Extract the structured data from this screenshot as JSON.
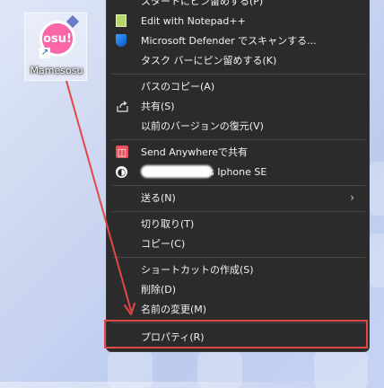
{
  "desktop_icon": {
    "label": "Mamesosu",
    "logo_text": "osu!"
  },
  "menu": {
    "items": [
      {
        "label": "スタートにピン留めする(P)",
        "icon": "none"
      },
      {
        "label": "Edit with Notepad++",
        "icon": "notepad-icon"
      },
      {
        "label": "Microsoft Defender でスキャンする...",
        "icon": "defender-shield-icon"
      },
      {
        "label": "タスク バーにピン留めする(K)",
        "icon": "none"
      },
      {
        "label": "パスのコピー(A)",
        "icon": "none"
      },
      {
        "label": "共有(S)",
        "icon": "share-icon"
      },
      {
        "label": "以前のバージョンの復元(V)",
        "icon": "none"
      },
      {
        "label": "Send Anywhereで共有",
        "icon": "send-anywhere-icon"
      },
      {
        "label": "s Iphone SE",
        "icon": "bluetooth-device-icon"
      },
      {
        "label": "送る(N)",
        "icon": "none"
      },
      {
        "label": "切り取り(T)",
        "icon": "none"
      },
      {
        "label": "コピー(C)",
        "icon": "none"
      },
      {
        "label": "ショートカットの作成(S)",
        "icon": "none"
      },
      {
        "label": "削除(D)",
        "icon": "none"
      },
      {
        "label": "名前の変更(M)",
        "icon": "none"
      },
      {
        "label": "プロパティ(R)",
        "icon": "none"
      }
    ],
    "submenu_chevron": "›"
  },
  "annotation": {
    "color": "#e04848",
    "highlighted_item": "プロパティ(R)"
  }
}
